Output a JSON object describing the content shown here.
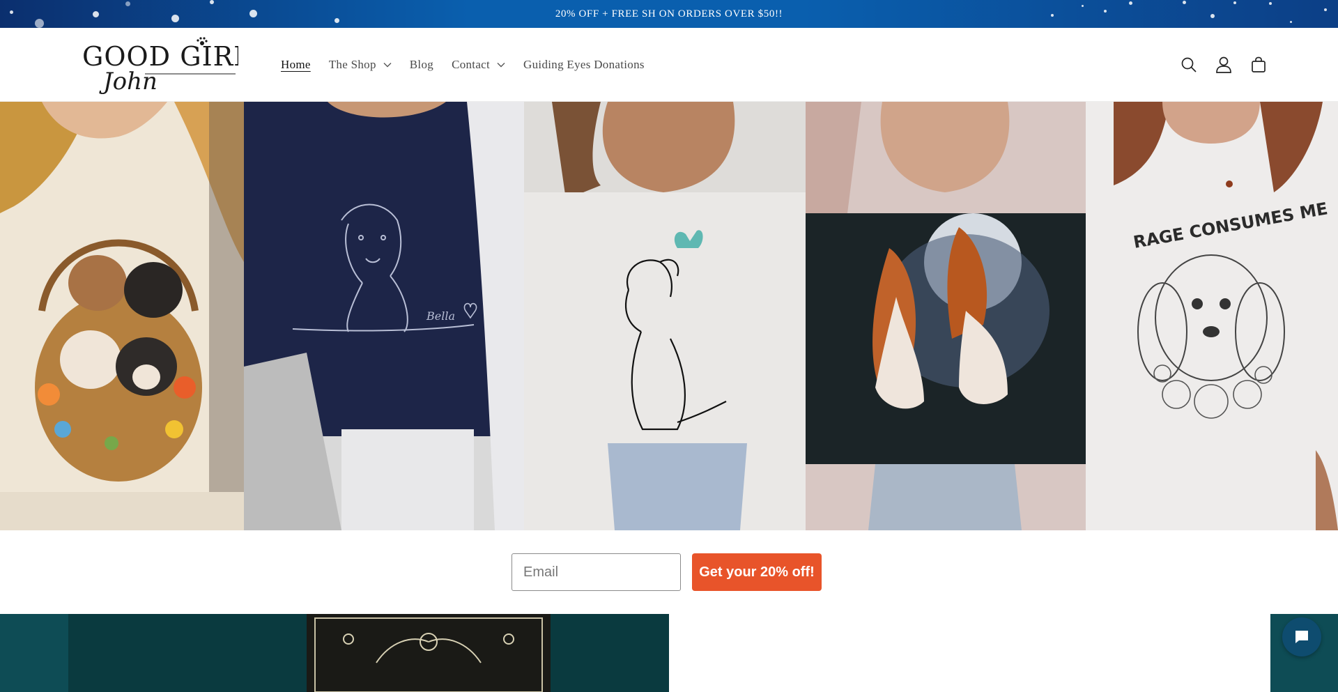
{
  "announcement": {
    "text": "20% OFF + FREE SH ON ORDERS OVER $50!!"
  },
  "brand": {
    "logo_text_top": "GOOD GIRL",
    "logo_text_script": "John"
  },
  "nav": {
    "items": [
      {
        "label": "Home",
        "active": true,
        "has_dropdown": false
      },
      {
        "label": "The Shop",
        "active": false,
        "has_dropdown": true
      },
      {
        "label": "Blog",
        "active": false,
        "has_dropdown": false
      },
      {
        "label": "Contact",
        "active": false,
        "has_dropdown": true
      },
      {
        "label": "Guiding Eyes Donations",
        "active": false,
        "has_dropdown": false
      }
    ]
  },
  "header_icons": [
    "search-icon",
    "account-icon",
    "cart-icon"
  ],
  "hero": {
    "panels": [
      {
        "name": "french-bulldog-basket-tee"
      },
      {
        "name": "line-art-terrier-sweatshirt",
        "text": "Bella"
      },
      {
        "name": "dachshund-butterfly-sweatshirt"
      },
      {
        "name": "cavalier-moon-sweatshirt"
      },
      {
        "name": "rage-consumes-me-tee",
        "text": "RAGE CONSUMES ME"
      }
    ]
  },
  "signup": {
    "email_placeholder": "Email",
    "email_value": "",
    "cta_label": "Get your 20% off!"
  },
  "colors": {
    "cta": "#e8542a",
    "announcement_bg": "#0a5fae",
    "teal": "#0e4c55",
    "chat": "#0e4c6f"
  }
}
